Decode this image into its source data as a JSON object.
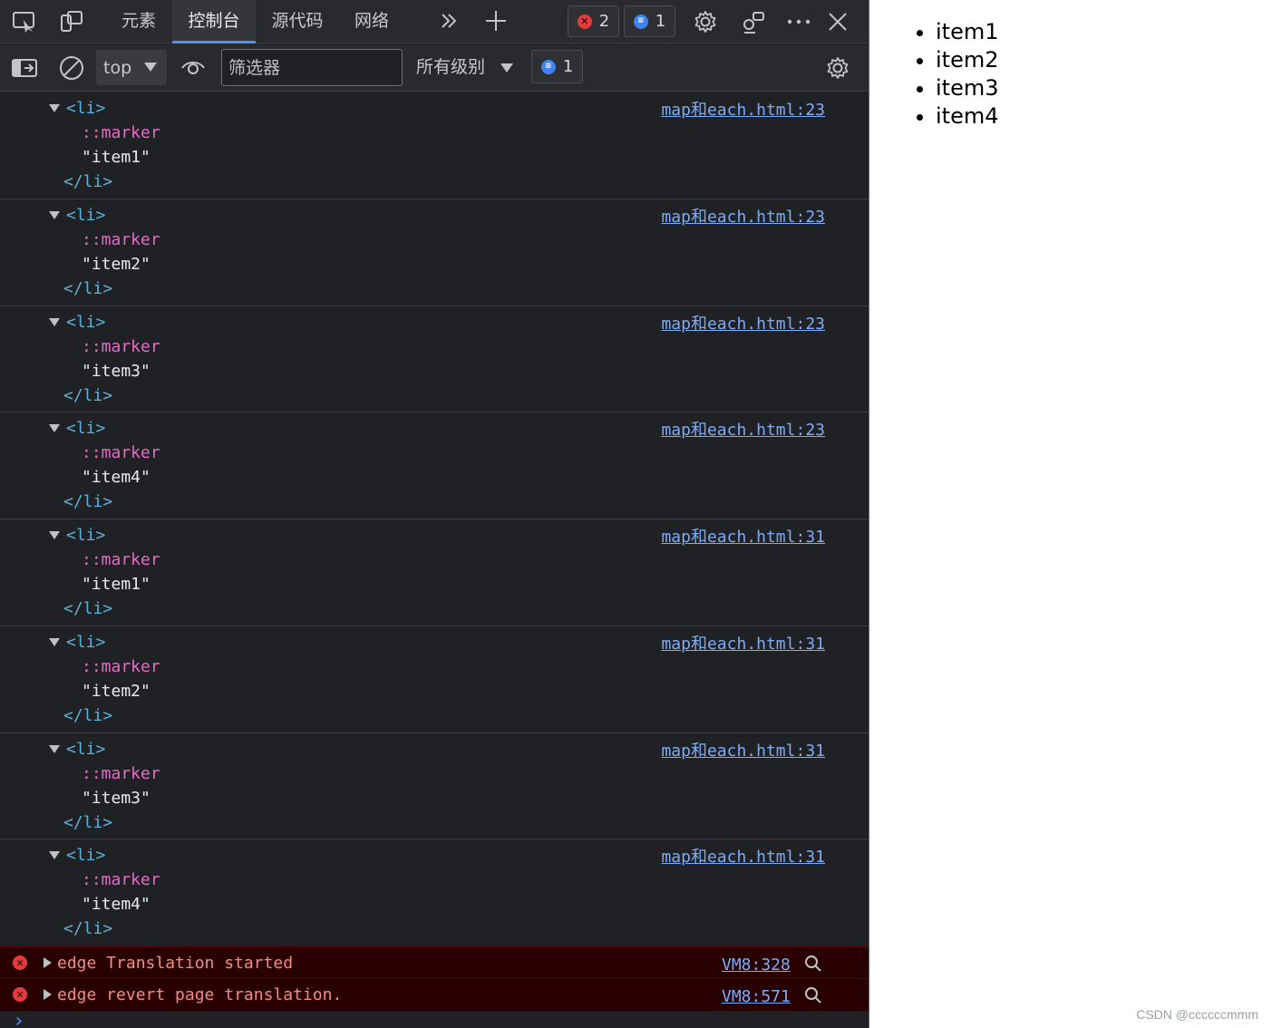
{
  "tabs": [
    {
      "label": "元素",
      "active": false
    },
    {
      "label": "控制台",
      "active": true
    },
    {
      "label": "源代码",
      "active": false
    },
    {
      "label": "网络",
      "active": false
    }
  ],
  "badges": {
    "errors": "2",
    "messages": "1"
  },
  "toolbar": {
    "context": "top",
    "filter_placeholder": "筛选器",
    "levels": "所有级别",
    "message_count": "1"
  },
  "entries": [
    {
      "open_tag": "<li>",
      "pseudo": "::marker",
      "text": "\"item1\"",
      "close_tag": "</li>",
      "source": "map和each.html:23"
    },
    {
      "open_tag": "<li>",
      "pseudo": "::marker",
      "text": "\"item2\"",
      "close_tag": "</li>",
      "source": "map和each.html:23"
    },
    {
      "open_tag": "<li>",
      "pseudo": "::marker",
      "text": "\"item3\"",
      "close_tag": "</li>",
      "source": "map和each.html:23"
    },
    {
      "open_tag": "<li>",
      "pseudo": "::marker",
      "text": "\"item4\"",
      "close_tag": "</li>",
      "source": "map和each.html:23"
    },
    {
      "open_tag": "<li>",
      "pseudo": "::marker",
      "text": "\"item1\"",
      "close_tag": "</li>",
      "source": "map和each.html:31"
    },
    {
      "open_tag": "<li>",
      "pseudo": "::marker",
      "text": "\"item2\"",
      "close_tag": "</li>",
      "source": "map和each.html:31"
    },
    {
      "open_tag": "<li>",
      "pseudo": "::marker",
      "text": "\"item3\"",
      "close_tag": "</li>",
      "source": "map和each.html:31"
    },
    {
      "open_tag": "<li>",
      "pseudo": "::marker",
      "text": "\"item4\"",
      "close_tag": "</li>",
      "source": "map和each.html:31"
    }
  ],
  "errors": [
    {
      "message": "edge Translation started",
      "source": "VM8:328"
    },
    {
      "message": "edge revert page translation.",
      "source": "VM8:571"
    }
  ],
  "prompt": "›",
  "page": {
    "items": [
      "item1",
      "item2",
      "item3",
      "item4"
    ]
  },
  "watermark": "CSDN @ccccccmmm"
}
